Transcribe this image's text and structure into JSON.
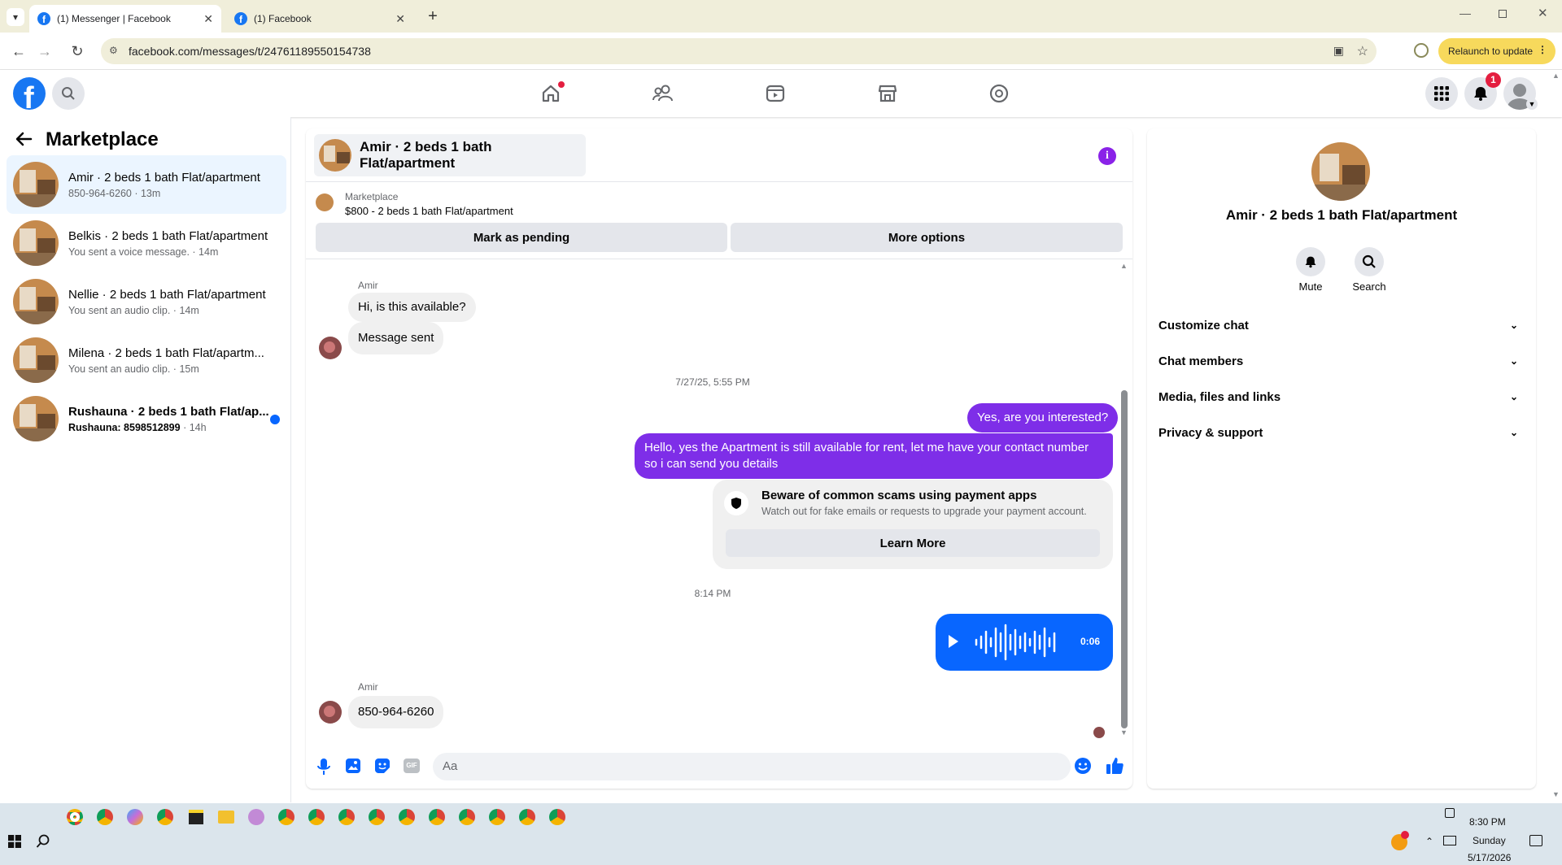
{
  "browser": {
    "tabs": [
      {
        "title": "(1) Messenger | Facebook"
      },
      {
        "title": "(1) Facebook"
      }
    ],
    "url": "facebook.com/messages/t/24761189550154738",
    "relaunch_label": "Relaunch to update"
  },
  "header": {
    "notification_count": "1"
  },
  "sidebar": {
    "title": "Marketplace",
    "conversations": [
      {
        "name": "Amir · 2 beds 1 bath Flat/apartment",
        "preview": "850-964-6260 · 13m",
        "active": true
      },
      {
        "name": "Belkis · 2 beds 1 bath Flat/apartment",
        "preview": "You sent a voice message. · 14m"
      },
      {
        "name": "Nellie · 2 beds 1 bath Flat/apartment",
        "preview": "You sent an audio clip. · 14m"
      },
      {
        "name": "Milena · 2 beds 1 bath Flat/apartm...",
        "preview": "You sent an audio clip. · 15m"
      },
      {
        "name": "Rushauna · 2 beds 1 bath Flat/ap...",
        "preview_bold": "Rushauna: 8598512899",
        "preview_time": " · 14h",
        "unread": true
      }
    ]
  },
  "chat": {
    "title": "Amir · 2 beds 1 bath Flat/apartment",
    "listing": {
      "source": "Marketplace",
      "summary": "$800 - 2 beds 1 bath Flat/apartment"
    },
    "buttons": {
      "pending": "Mark as pending",
      "more": "More options"
    },
    "messages": {
      "sender1": "Amir",
      "m1": "Hi, is this available?",
      "m2": "Message sent",
      "timestamp1": "7/27/25, 5:55 PM",
      "m3": "Yes, are you interested?",
      "m4": "Hello, yes the Apartment is still available for rent, let me have your contact number so i can send you details",
      "warning_title": "Beware of common scams using payment apps",
      "warning_text": "Watch out for fake emails or requests to upgrade your payment account.",
      "learn_more": "Learn More",
      "timestamp2": "8:14 PM",
      "voice_duration": "0:06",
      "sender2": "Amir",
      "m5": "850-964-6260"
    },
    "composer_placeholder": "Aa"
  },
  "info": {
    "title": "Amir · 2 beds 1 bath Flat/apartment",
    "mute_label": "Mute",
    "search_label": "Search",
    "sections": [
      "Customize chat",
      "Chat members",
      "Media, files and links",
      "Privacy & support"
    ]
  },
  "taskbar": {
    "time": "8:30 PM",
    "day": "Sunday",
    "date": "5/17/2026"
  },
  "colors": {
    "brand": "#1877f2",
    "outgoing": "#7e2ee8",
    "voice": "#0866ff",
    "unread": "#0866ff"
  }
}
